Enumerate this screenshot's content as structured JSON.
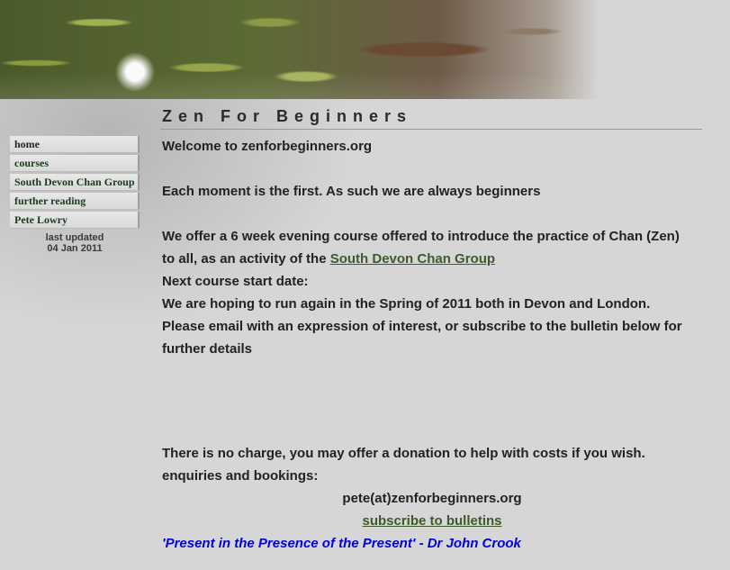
{
  "site": {
    "title": "Zen For Beginners"
  },
  "nav": {
    "items": [
      {
        "label": "home"
      },
      {
        "label": "courses"
      },
      {
        "label": "South Devon Chan Group"
      },
      {
        "label": "further reading"
      },
      {
        "label": "Pete Lowry"
      }
    ]
  },
  "updated": {
    "label": "last updated",
    "date": "04 Jan 2011"
  },
  "content": {
    "welcome": "Welcome to zenforbeginners.org",
    "moment": "Each moment is the first.  As such we are always beginners",
    "offer_text": "We offer a 6 week evening course offered to introduce the practice of Chan (Zen) to all, as an activity of the ",
    "offer_link": "South Devon Chan Group ",
    "next_course": "Next course start date:",
    "hoping": "We are hoping to run again in the Spring of 2011 both in Devon and London.",
    "email_text": "Please email with an expression of interest, or subscribe to the bulletin below for further details",
    "charge": "There is no charge, you may offer a donation to help with costs if you wish.",
    "enquiries": "enquiries and bookings:",
    "email": "pete(at)zenforbeginners.org",
    "subscribe": "subscribe to bulletins",
    "quote": "'Present in the Presence of the Present' - Dr John Crook"
  },
  "colors": {
    "link": "#3f5a2a",
    "quote": "#0000e0",
    "nav_text": "#1c3a1c"
  }
}
